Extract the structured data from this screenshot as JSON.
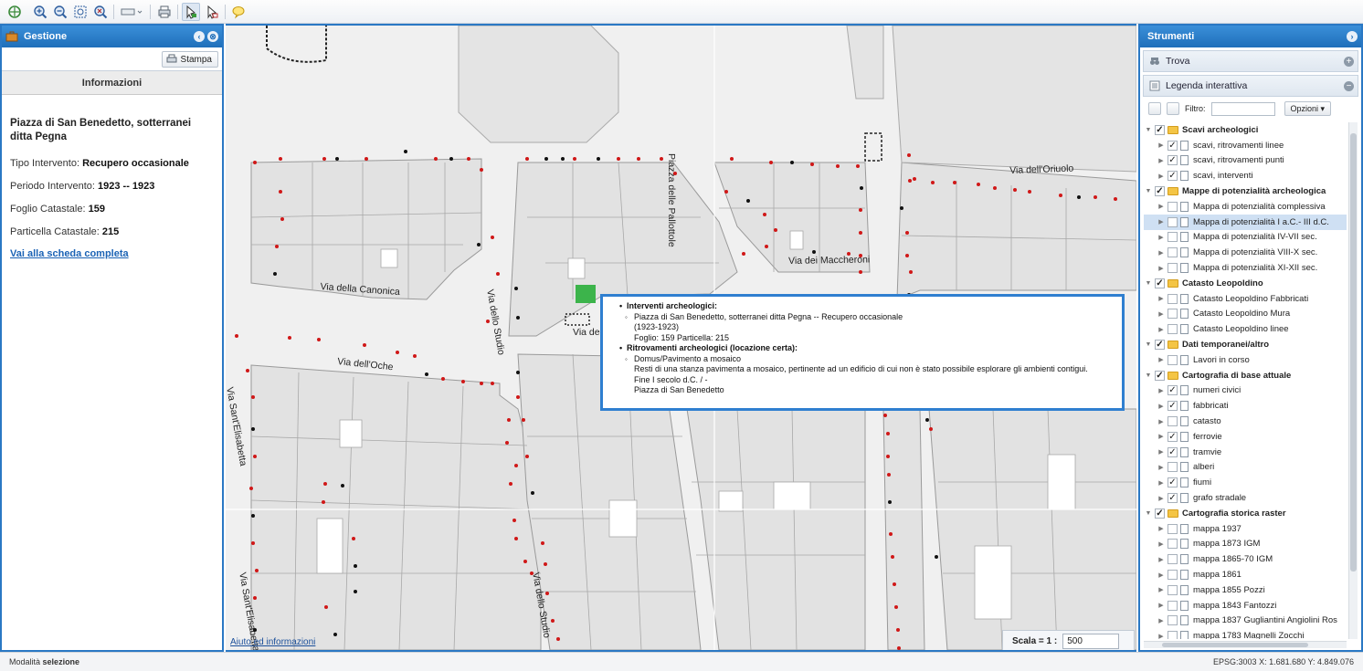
{
  "toolbar": {
    "icons": [
      "zoom-all-icon",
      "zoom-in-icon",
      "zoom-out-icon",
      "zoom-box-icon",
      "zoom-prev-icon",
      "print-icon",
      "select-icon",
      "select-area-icon",
      "info-bubble-icon"
    ]
  },
  "left_panel": {
    "title": "Gestione",
    "stampa_label": "Stampa",
    "info_header": "Informazioni",
    "place_title": "Piazza di San Benedetto, sotterranei ditta Pegna",
    "rows": [
      {
        "label": "Tipo Intervento: ",
        "value": "Recupero occasionale"
      },
      {
        "label": "Periodo Intervento: ",
        "value": "1923 -- 1923"
      },
      {
        "label": "Foglio Catastale: ",
        "value": "159"
      },
      {
        "label": "Particella Catastale: ",
        "value": "215"
      }
    ],
    "link_label": "Vai alla scheda completa"
  },
  "map": {
    "streets": {
      "canonica": "Via della Canonica",
      "oche": "Via dell'Oche",
      "studio": "Via dello Studio",
      "studio2": "Via dello Studio",
      "pallottole": "Piazza delle Pallottole",
      "maccheroni": "Via dei Maccheroni",
      "oriuolo": "Via dell'Oriuolo",
      "elisabetta": "Via Sant'Elisabetta",
      "elisabetta2": "Via Sant'Elisabetta",
      "de": "Via de"
    },
    "popup": {
      "sec1": "Interventi archeologici:",
      "sec1_item": "Piazza di San Benedetto, sotterranei ditta Pegna -- Recupero occasionale",
      "sec1_years": "(1923-1923)",
      "sec1_foglio": "Foglio: 159 Particella: 215",
      "sec2": "Ritrovamenti archeologici (locazione certa):",
      "sec2_item": "Domus/Pavimento a mosaico",
      "sec2_desc": "Resti di una stanza pavimenta a mosaico, pertinente ad un edificio di cui non è stato possibile esplorare gli ambienti contigui.",
      "sec2_date": "Fine I secolo d.C. / -",
      "sec2_place": "Piazza di San Benedetto"
    },
    "aiuto_label": "Aiuto ed informazioni",
    "scala_label": "Scala = 1 :",
    "scala_value": "500"
  },
  "right_panel": {
    "title": "Strumenti",
    "trova_label": "Trova",
    "legenda_label": "Legenda interattiva",
    "filtro_label": "Filtro:",
    "opzioni_label": "Opzioni",
    "tree": [
      {
        "label": "Scavi archeologici",
        "group": true,
        "checked": true
      },
      {
        "label": "scavi, ritrovamenti linee",
        "group": false,
        "checked": true
      },
      {
        "label": "scavi, ritrovamenti punti",
        "group": false,
        "checked": true
      },
      {
        "label": "scavi, interventi",
        "group": false,
        "checked": true
      },
      {
        "label": "Mappe di potenzialità archeologica",
        "group": true,
        "checked": true
      },
      {
        "label": "Mappa di potenzialità complessiva",
        "group": false,
        "checked": false
      },
      {
        "label": "Mappa di potenzialità I a.C.- III d.C.",
        "group": false,
        "checked": false,
        "selected": true
      },
      {
        "label": "Mappa di potenzialità IV-VII sec.",
        "group": false,
        "checked": false
      },
      {
        "label": "Mappa di potenzialità VIII-X sec.",
        "group": false,
        "checked": false
      },
      {
        "label": "Mappa di potenzialità XI-XII sec.",
        "group": false,
        "checked": false
      },
      {
        "label": "Catasto Leopoldino",
        "group": true,
        "checked": true
      },
      {
        "label": "Catasto Leopoldino Fabbricati",
        "group": false,
        "checked": false
      },
      {
        "label": "Catasto Leopoldino Mura",
        "group": false,
        "checked": false
      },
      {
        "label": "Catasto Leopoldino linee",
        "group": false,
        "checked": false
      },
      {
        "label": "Dati temporanei/altro",
        "group": true,
        "checked": true
      },
      {
        "label": "Lavori in corso",
        "group": false,
        "checked": false
      },
      {
        "label": "Cartografia di base attuale",
        "group": true,
        "checked": true
      },
      {
        "label": "numeri civici",
        "group": false,
        "checked": true
      },
      {
        "label": "fabbricati",
        "group": false,
        "checked": true
      },
      {
        "label": "catasto",
        "group": false,
        "checked": false
      },
      {
        "label": "ferrovie",
        "group": false,
        "checked": true
      },
      {
        "label": "tramvie",
        "group": false,
        "checked": true
      },
      {
        "label": "alberi",
        "group": false,
        "checked": false
      },
      {
        "label": "fiumi",
        "group": false,
        "checked": true
      },
      {
        "label": "grafo stradale",
        "group": false,
        "checked": true
      },
      {
        "label": "Cartografia storica raster",
        "group": true,
        "checked": true
      },
      {
        "label": "mappa 1937",
        "group": false,
        "checked": false
      },
      {
        "label": "mappa 1873 IGM",
        "group": false,
        "checked": false
      },
      {
        "label": "mappa 1865-70 IGM",
        "group": false,
        "checked": false
      },
      {
        "label": "mappa 1861",
        "group": false,
        "checked": false
      },
      {
        "label": "mappa 1855 Pozzi",
        "group": false,
        "checked": false
      },
      {
        "label": "mappa 1843 Fantozzi",
        "group": false,
        "checked": false
      },
      {
        "label": "mappa 1837 Gugliantini Angiolini Ros",
        "group": false,
        "checked": false
      },
      {
        "label": "mappa 1783 Magnelli Zocchi",
        "group": false,
        "checked": false
      }
    ]
  },
  "status": {
    "left_prefix": "Modalità ",
    "left_mode": "selezione",
    "right": "EPSG:3003  X: 1.681.680  Y: 4.849.076"
  },
  "colors": {
    "accent": "#2a78c4",
    "civic_red": "#d01818",
    "green_marker": "#3cb44b"
  }
}
